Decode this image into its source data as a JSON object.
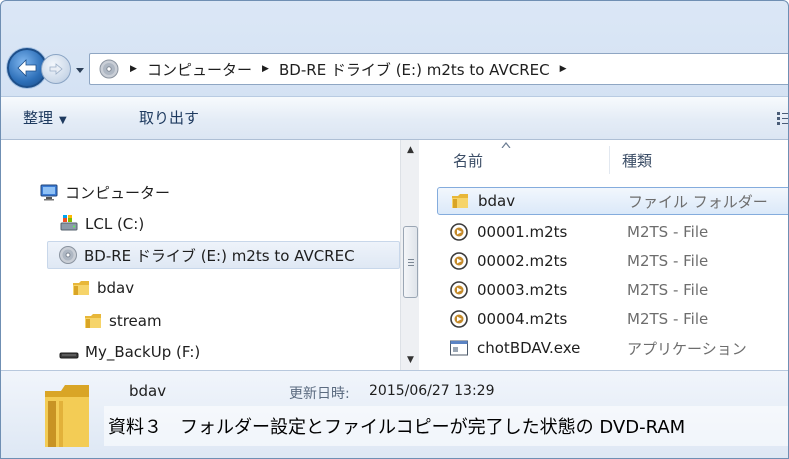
{
  "address_bar": {
    "segments": [
      "コンピューター",
      "BD-RE ドライブ (E:) m2ts to AVCREC"
    ]
  },
  "toolbar": {
    "organize_label": "整理",
    "eject_label": "取り出す"
  },
  "nav_tree": [
    {
      "label": "コンピューター",
      "icon": "computer-icon"
    },
    {
      "label": "LCL (C:)",
      "icon": "hard-disk-icon"
    },
    {
      "label": "BD-RE ドライブ (E:) m2ts to AVCREC",
      "icon": "optical-disc-icon",
      "selected": true
    },
    {
      "label": "bdav",
      "icon": "folder-icon"
    },
    {
      "label": "stream",
      "icon": "folder-icon"
    },
    {
      "label": "My_BackUp (F:)",
      "icon": "removable-drive-icon"
    }
  ],
  "file_list": {
    "columns": [
      "名前",
      "種類"
    ],
    "rows": [
      {
        "name": "bdav",
        "type": "ファイル フォルダー",
        "icon": "folder-icon",
        "selected": true
      },
      {
        "name": "00001.m2ts",
        "type": "M2TS - File",
        "icon": "media-file-icon"
      },
      {
        "name": "00002.m2ts",
        "type": "M2TS - File",
        "icon": "media-file-icon"
      },
      {
        "name": "00003.m2ts",
        "type": "M2TS - File",
        "icon": "media-file-icon"
      },
      {
        "name": "00004.m2ts",
        "type": "M2TS - File",
        "icon": "media-file-icon"
      },
      {
        "name": "chotBDAV.exe",
        "type": "アプリケーション",
        "icon": "exe-file-icon"
      }
    ]
  },
  "details": {
    "name": "bdav",
    "modified_label": "更新日時:",
    "modified_value": "2015/06/27 13:29"
  },
  "caption": "資料３　フォルダー設定とファイルコピーが完了した状態の DVD-RAM",
  "colors": {
    "accent": "#2d6fb8",
    "folder": "#e8b739",
    "selection": "#dbe9f9"
  }
}
